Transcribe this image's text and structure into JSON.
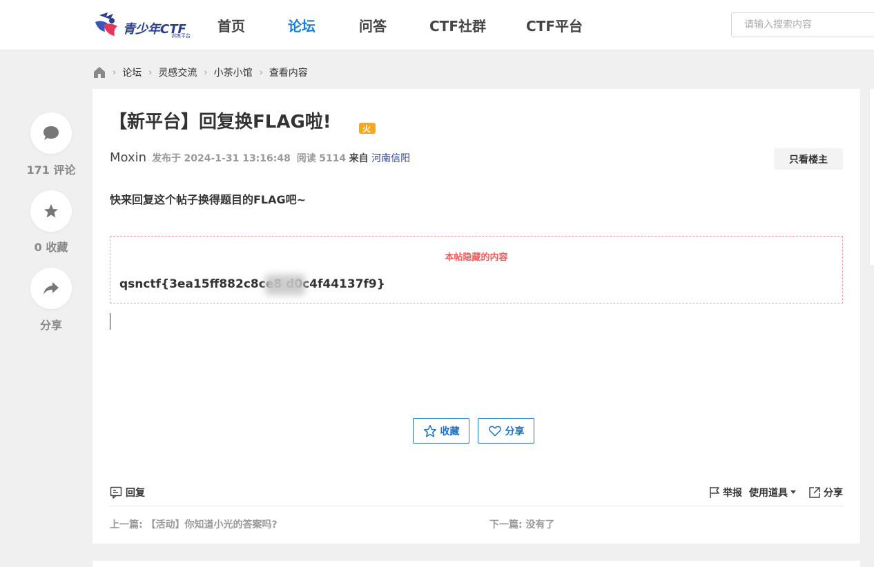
{
  "header": {
    "logo_text": "青少年CTF",
    "logo_sub": "训练平台",
    "nav": [
      {
        "label": "首页"
      },
      {
        "label": "论坛"
      },
      {
        "label": "问答"
      },
      {
        "label": "CTF社群"
      },
      {
        "label": "CTF平台"
      }
    ],
    "search_placeholder": "请输入搜索内容"
  },
  "breadcrumb": [
    "论坛",
    "灵感交流",
    "小茶小馆",
    "查看内容"
  ],
  "side": {
    "comments": "171 评论",
    "favorites": "0 收藏",
    "share": "分享"
  },
  "post": {
    "title": "【新平台】回复换FLAG啦!",
    "hot_badge": "火",
    "author": "Moxin",
    "published_label": "发布于",
    "published_at": "2024-1-31 13:16:48",
    "read_label": "阅读",
    "read_count": "5114",
    "from_label": "来自",
    "location": "河南信阳",
    "only_op_label": "只看楼主",
    "body": "快来回复这个帖子换得题目的FLAG吧~",
    "hidden_title": "本帖隐藏的内容",
    "flag_text": "qsnctf{3ea15ff882c8ce8        d0c4f44137f9}",
    "favorite_button": "收藏",
    "share_button": "分享"
  },
  "footer": {
    "reply_label": "回复",
    "report_label": "举报",
    "tools_label": "使用道具",
    "share_label": "分享",
    "prev": "上一篇: 【活动】你知道小光的答案吗?",
    "next": "下一篇: 没有了"
  },
  "colors": {
    "accent": "#1a7fd4",
    "hidden_border": "#f2a0a0",
    "hidden_title": "#f25a5a",
    "logo": "#2b3f8f"
  }
}
